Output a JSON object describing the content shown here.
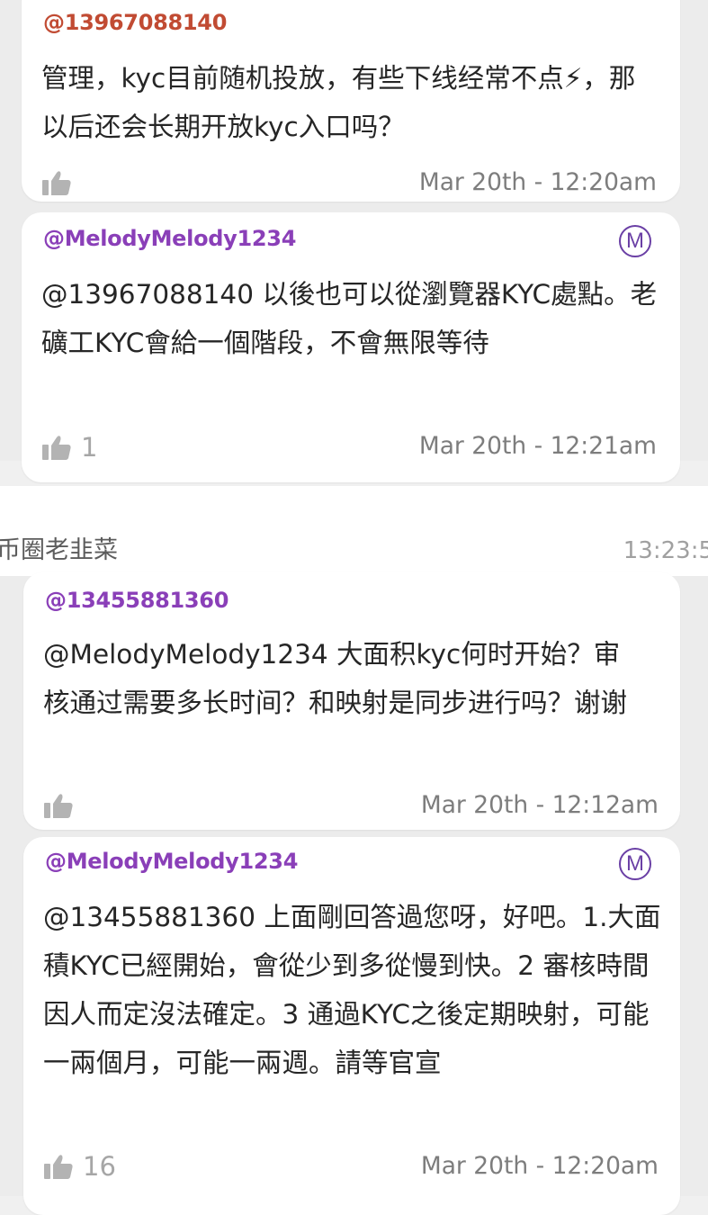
{
  "thread1": {
    "comment": {
      "author": "@13967088140",
      "text": "管理，kyc目前随机投放，有些下线经常不点⚡，那以后还会长期开放kyc入口吗？",
      "likes": "",
      "time": "Mar 20th - 12:20am"
    },
    "reply": {
      "author": "@MelodyMelody1234",
      "badge": "M",
      "text": "@13967088140 以後也可以從瀏覽器KYC處點。老礦工KYC會給一個階段，不會無限等待",
      "likes": "1",
      "time": "Mar 20th - 12:21am"
    }
  },
  "chat_header": {
    "sender": "币圈老韭菜",
    "time": "13:23:5"
  },
  "thread2": {
    "comment": {
      "author": "@13455881360",
      "text": "@MelodyMelody1234 大面积kyc何时开始？审核通过需要多长时间？和映射是同步进行吗？谢谢",
      "likes": "",
      "time": "Mar 20th - 12:12am"
    },
    "reply": {
      "author": "@MelodyMelody1234",
      "badge": "M",
      "text": "@13455881360 上面剛回答過您呀，好吧。1.大面積KYC已經開始，會從少到多從慢到快。2 審核時間因人而定沒法確定。3 通過KYC之後定期映射，可能一兩個月，可能一兩週。請等官宣",
      "likes": "16",
      "time": "Mar 20th - 12:20am"
    }
  },
  "colors": {
    "author_red": "#c14b33",
    "author_purple": "#8a3fb8",
    "moderator_badge": "#6a3fa5"
  },
  "icons": {
    "like": "thumbs-up-icon",
    "moderator": "moderator-badge-icon"
  }
}
